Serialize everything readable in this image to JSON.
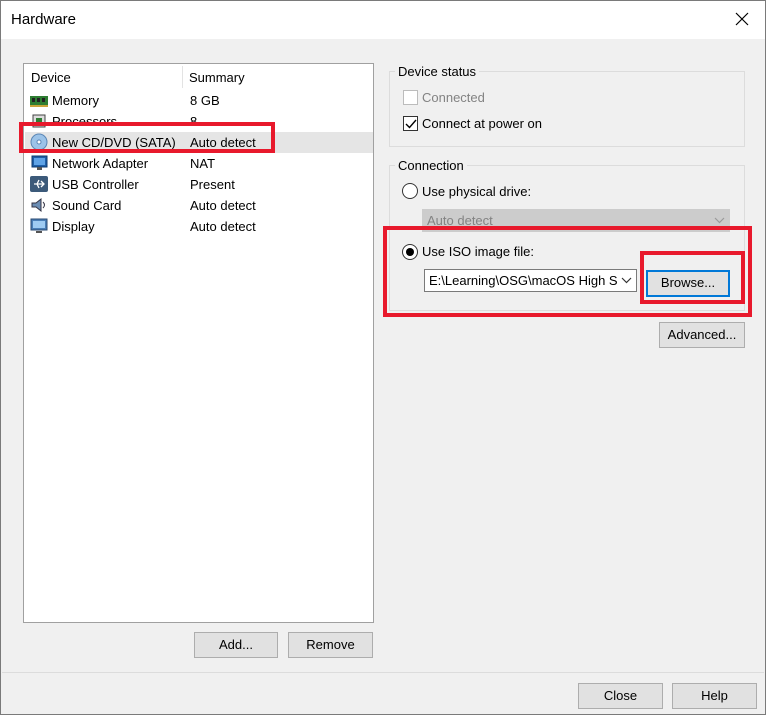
{
  "window": {
    "title": "Hardware"
  },
  "device_list": {
    "columns": [
      "Device",
      "Summary"
    ],
    "rows": [
      {
        "device": "Memory",
        "summary": "8 GB",
        "icon": "memory-icon"
      },
      {
        "device": "Processors",
        "summary": "8",
        "icon": "processor-icon"
      },
      {
        "device": "New CD/DVD (SATA)",
        "summary": "Auto detect",
        "icon": "cd-dvd-icon",
        "selected": true
      },
      {
        "device": "Network Adapter",
        "summary": "NAT",
        "icon": "network-adapter-icon"
      },
      {
        "device": "USB Controller",
        "summary": "Present",
        "icon": "usb-icon"
      },
      {
        "device": "Sound Card",
        "summary": "Auto detect",
        "icon": "sound-card-icon"
      },
      {
        "device": "Display",
        "summary": "Auto detect",
        "icon": "display-icon"
      }
    ]
  },
  "buttons": {
    "add": "Add...",
    "remove": "Remove",
    "browse": "Browse...",
    "advanced": "Advanced...",
    "close": "Close",
    "help": "Help"
  },
  "device_status": {
    "label": "Device status",
    "connected": {
      "label": "Connected",
      "checked": false,
      "enabled": false
    },
    "connect_at_power_on": {
      "label": "Connect at power on",
      "checked": true
    }
  },
  "connection": {
    "label": "Connection",
    "physical_drive": {
      "label": "Use physical drive:",
      "selected": false,
      "value": "Auto detect"
    },
    "iso_image": {
      "label": "Use ISO image file:",
      "selected": true,
      "value": "E:\\Learning\\OSG\\macOS High S"
    }
  },
  "colors": {
    "highlight": "#e8192c",
    "focus": "#0078d7",
    "selected_row": "#e5e5e5"
  }
}
